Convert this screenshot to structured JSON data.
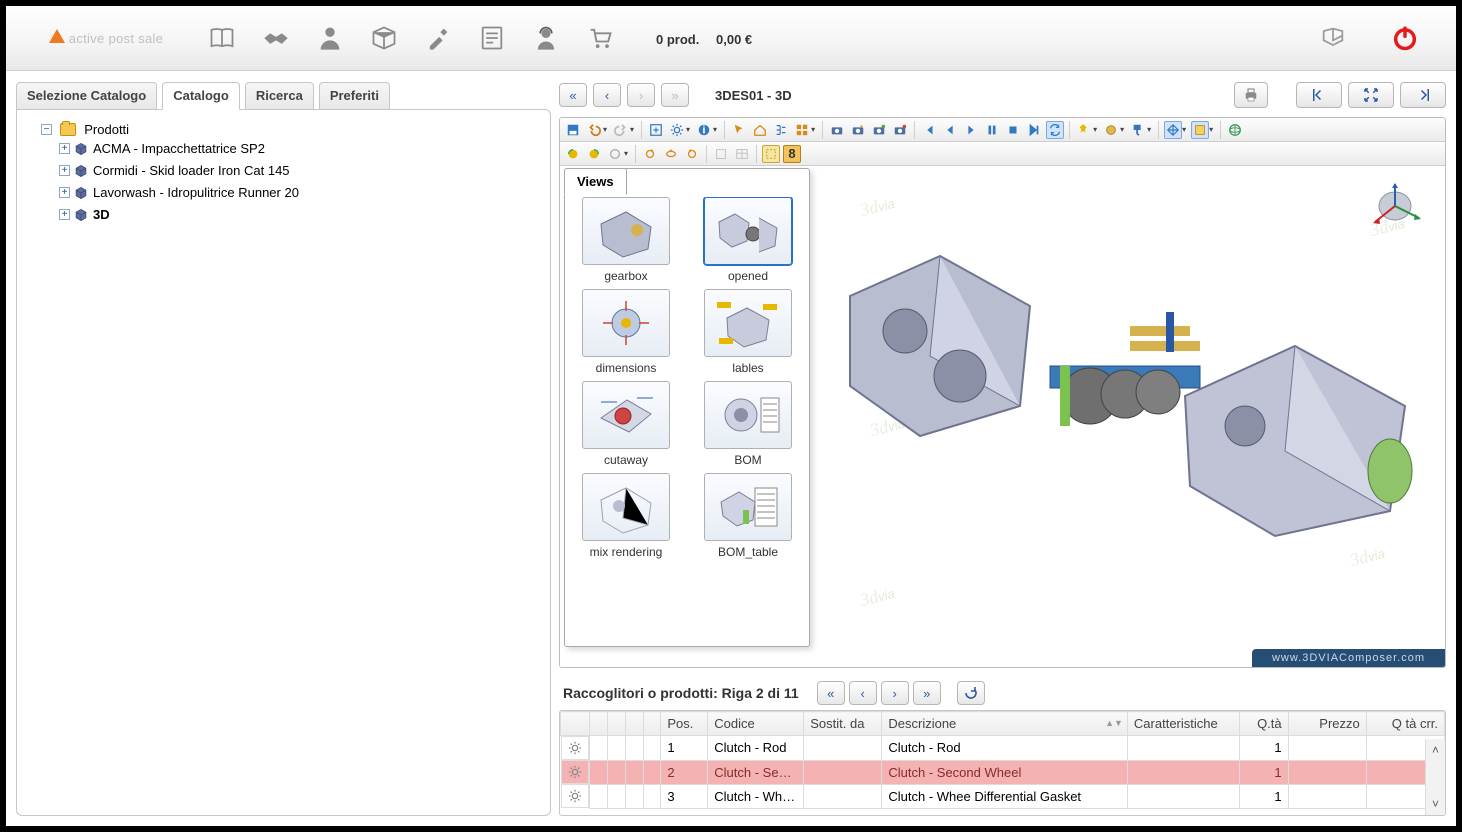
{
  "topbar": {
    "logo_text": "active post sale",
    "cart_count": "0 prod.",
    "cart_total": "0,00 €"
  },
  "tabs": {
    "selezione": "Selezione Catalogo",
    "catalogo": "Catalogo",
    "ricerca": "Ricerca",
    "preferiti": "Preferiti"
  },
  "tree": {
    "root": "Prodotti",
    "items": [
      "ACMA - Impacchettatrice SP2",
      "Cormidi - Skid loader Iron Cat 145",
      "Lavorwash - Idropulitrice Runner 20",
      "3D"
    ]
  },
  "breadcrumb": "3DES01 - 3D",
  "views": {
    "tab": "Views",
    "items": [
      "gearbox",
      "opened",
      "dimensions",
      "lables",
      "cutaway",
      "BOM",
      "mix rendering",
      "BOM_table"
    ],
    "selected": 1
  },
  "viewer": {
    "footer": "www.3DVIAComposer.com"
  },
  "bottom": {
    "title": "Raccoglitori o prodotti: Riga 2 di 11",
    "columns": {
      "pos": "Pos.",
      "codice": "Codice",
      "sostit": "Sostit. da",
      "descr": "Descrizione",
      "carat": "Caratteristiche",
      "qta": "Q.tà",
      "prezzo": "Prezzo",
      "qtacrr": "Q tà crr."
    },
    "rows": [
      {
        "pos": "1",
        "codice": "Clutch - Rod",
        "descr": "Clutch - Rod",
        "qta": "1"
      },
      {
        "pos": "2",
        "codice": "Clutch - Second Wheel",
        "descr": "Clutch - Second Wheel",
        "qta": "1",
        "selected": true
      },
      {
        "pos": "3",
        "codice": "Clutch - Whee Differential Gasket",
        "descr": "Clutch - Whee Differential Gasket",
        "qta": "1"
      }
    ]
  }
}
